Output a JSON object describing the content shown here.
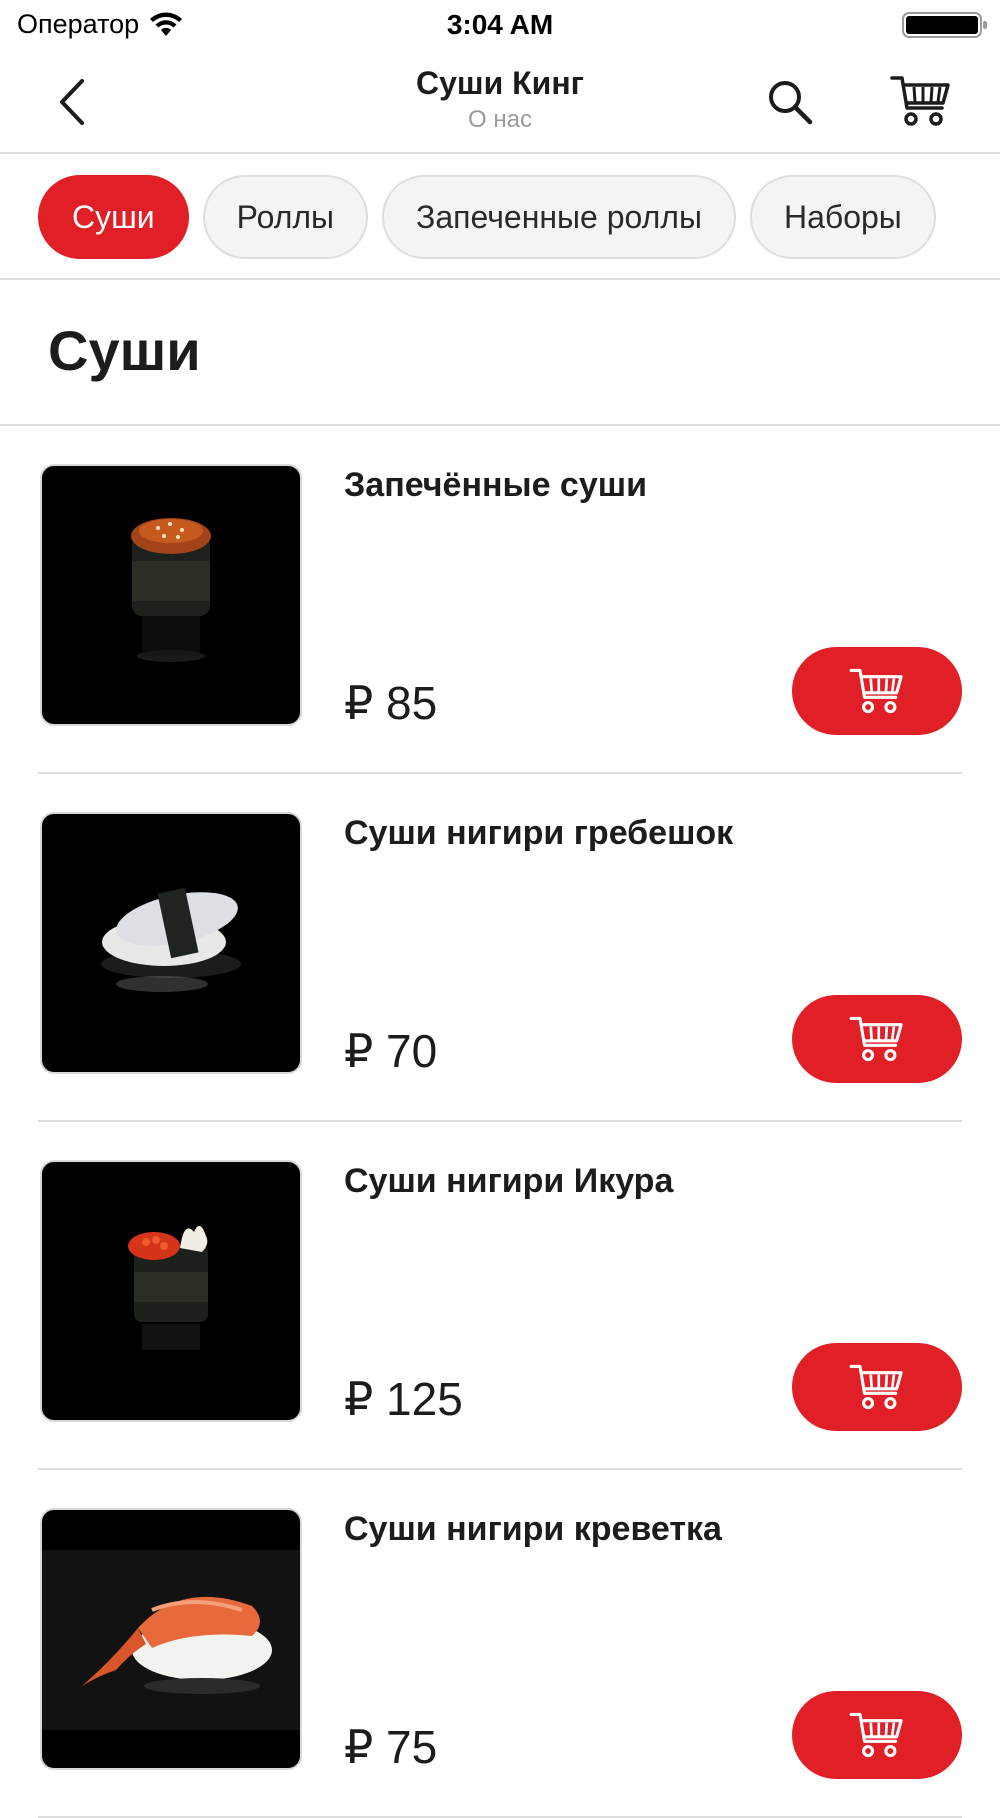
{
  "status_bar": {
    "carrier": "Оператор",
    "time": "3:04 AM"
  },
  "nav": {
    "title": "Суши Кинг",
    "subtitle": "О нас"
  },
  "tabs": [
    {
      "label": "Суши",
      "active": true
    },
    {
      "label": "Роллы",
      "active": false
    },
    {
      "label": "Запеченные роллы",
      "active": false
    },
    {
      "label": "Наборы",
      "active": false
    }
  ],
  "section": {
    "title": "Суши"
  },
  "products": [
    {
      "name": "Запечённые суши",
      "price": "₽ 85",
      "image": "baked-sushi"
    },
    {
      "name": "Суши нигири гребешок",
      "price": "₽ 70",
      "image": "scallop-nigiri"
    },
    {
      "name": "Суши нигири Икура",
      "price": "₽ 125",
      "image": "ikura-gunkan"
    },
    {
      "name": "Суши нигири креветка",
      "price": "₽ 75",
      "image": "shrimp-nigiri"
    }
  ],
  "colors": {
    "accent": "#e01f26",
    "divider": "#dcdcdc",
    "subtitle": "#9a9a9a"
  }
}
